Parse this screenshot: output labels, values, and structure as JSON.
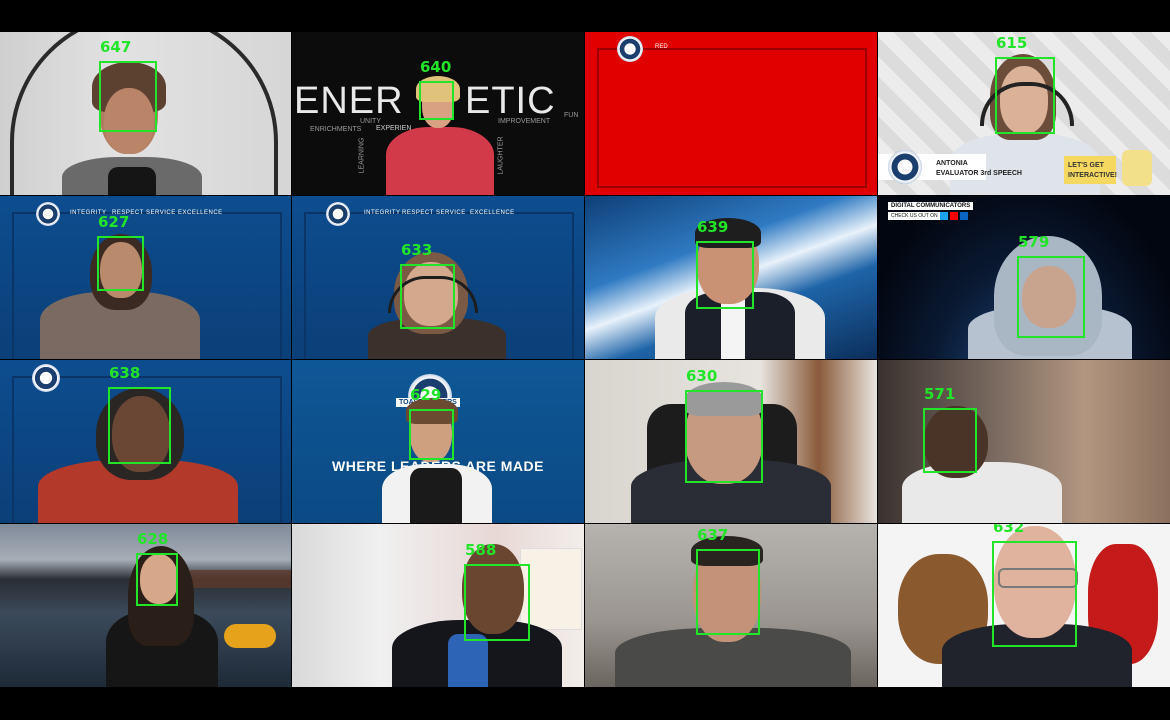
{
  "meeting": {
    "tiles": [
      {
        "id": "tile-1",
        "face_id": "647"
      },
      {
        "id": "tile-2",
        "face_id": "640",
        "bg_words": {
          "main": "ENER",
          "main2": "ETIC",
          "w1": "ENRICHMENTS",
          "w2": "UNITY",
          "w3": "EXPERIEN",
          "w4": "IMPROVEMENT",
          "w5": "FUN",
          "w6": "LEARNING",
          "w7": "LAUGHTER"
        }
      },
      {
        "id": "tile-3",
        "face_id": "",
        "label": "RED"
      },
      {
        "id": "tile-4",
        "face_id": "615",
        "caption_name": "ANTONIA",
        "caption_role": "EVALUATOR 3rd SPEECH",
        "caption_cta_1": "LET'S GET",
        "caption_cta_2": "INTERACTIVE!"
      },
      {
        "id": "tile-5",
        "face_id": "627",
        "banner": [
          "INTEGRITY",
          "RESPECT",
          "SERVICE",
          "EXCELLENCE"
        ]
      },
      {
        "id": "tile-6",
        "face_id": "633",
        "banner": [
          "INTEGRITY",
          "RESPECT",
          "SERVICE",
          "EXCELLENCE"
        ]
      },
      {
        "id": "tile-7",
        "face_id": "639"
      },
      {
        "id": "tile-8",
        "face_id": "579",
        "club_name": "DIGITAL COMMUNICATORS",
        "club_sub": "CHECK US OUT ON"
      },
      {
        "id": "tile-9",
        "face_id": "638"
      },
      {
        "id": "tile-10",
        "face_id": "629",
        "sign_top": "TOASTMASTERS",
        "tagline": "WHERE LEADERS ARE MADE"
      },
      {
        "id": "tile-11",
        "face_id": "630"
      },
      {
        "id": "tile-12",
        "face_id": "571"
      },
      {
        "id": "tile-13",
        "face_id": "628"
      },
      {
        "id": "tile-14",
        "face_id": "588"
      },
      {
        "id": "tile-15",
        "face_id": "637"
      },
      {
        "id": "tile-16",
        "face_id": "632"
      }
    ]
  },
  "colors": {
    "detection_box": "#22e52a",
    "tm_blue": "#0e4a86",
    "red_panel": "#e00000"
  }
}
